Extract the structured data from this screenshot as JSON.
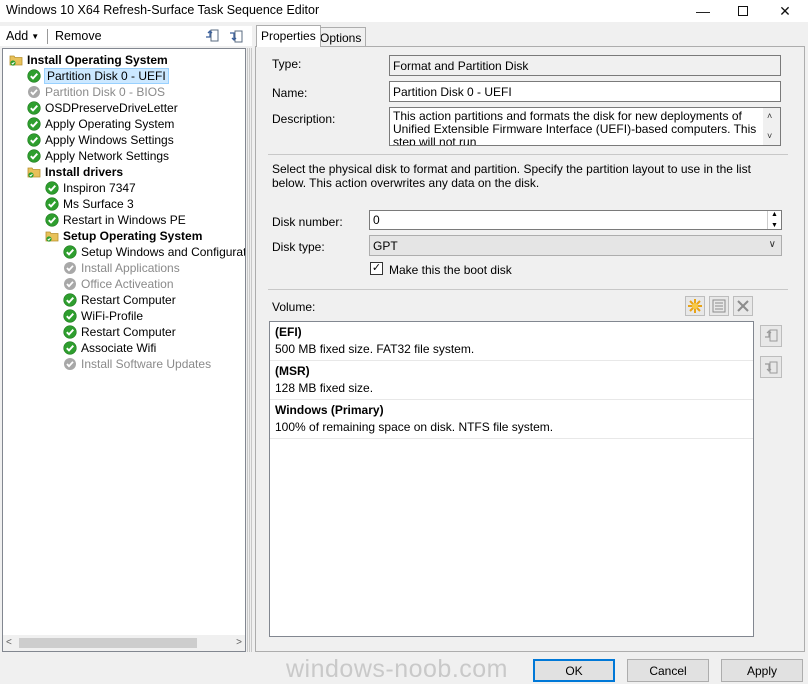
{
  "window": {
    "title": "Windows 10 X64 Refresh-Surface Task Sequence Editor",
    "min_glyph": "—",
    "close_glyph": "✕"
  },
  "toolbar": {
    "add_label": "Add",
    "add_arrow": "▼",
    "remove_label": "Remove"
  },
  "tree": {
    "items": [
      {
        "label": "Install Operating System",
        "type": "group"
      },
      {
        "label": "Partition Disk 0 - UEFI",
        "type": "step",
        "state": "ok"
      },
      {
        "label": "Partition Disk 0 - BIOS",
        "type": "step",
        "state": "disabled"
      },
      {
        "label": "OSDPreserveDriveLetter",
        "type": "step",
        "state": "ok"
      },
      {
        "label": "Apply Operating System",
        "type": "step",
        "state": "ok"
      },
      {
        "label": "Apply Windows Settings",
        "type": "step",
        "state": "ok"
      },
      {
        "label": "Apply Network Settings",
        "type": "step",
        "state": "ok"
      },
      {
        "label": "Install drivers",
        "type": "group"
      },
      {
        "label": "Inspiron 7347",
        "type": "step",
        "state": "ok"
      },
      {
        "label": "Ms Surface 3",
        "type": "step",
        "state": "ok"
      },
      {
        "label": "Restart in Windows PE",
        "type": "step",
        "state": "ok"
      },
      {
        "label": "Setup Operating System",
        "type": "group"
      },
      {
        "label": "Setup Windows and Configuration",
        "type": "step",
        "state": "ok"
      },
      {
        "label": "Install Applications",
        "type": "step",
        "state": "disabled"
      },
      {
        "label": "Office Activeation",
        "type": "step",
        "state": "disabled"
      },
      {
        "label": "Restart Computer",
        "type": "step",
        "state": "ok"
      },
      {
        "label": "WiFi-Profile",
        "type": "step",
        "state": "ok"
      },
      {
        "label": "Restart Computer",
        "type": "step",
        "state": "ok"
      },
      {
        "label": "Associate Wifi",
        "type": "step",
        "state": "ok"
      },
      {
        "label": "Install Software Updates",
        "type": "step",
        "state": "disabled"
      }
    ],
    "scroll_left": "<",
    "scroll_right": ">"
  },
  "tabs": {
    "properties": "Properties",
    "options": "Options"
  },
  "properties": {
    "type_label": "Type:",
    "type_value": "Format and Partition Disk",
    "name_label": "Name:",
    "name_value": "Partition Disk 0 - UEFI",
    "description_label": "Description:",
    "description_value": "This action partitions and formats the disk for new deployments of Unified Extensible Firmware Interface (UEFI)-based computers. This step will not run",
    "scroll_up": "˄",
    "scroll_down": "˅",
    "info_text": "Select the physical disk to format and partition. Specify the partition layout to use in the list below. This action overwrites any data on the disk.",
    "disk_number_label": "Disk number:",
    "disk_number_value": "0",
    "spin_up": "▲",
    "spin_down": "▼",
    "disk_type_label": "Disk type:",
    "disk_type_value": "GPT",
    "disk_type_chevron": "∨",
    "boot_disk_label": "Make this the boot disk",
    "boot_disk_checked": true,
    "check_glyph": "✓",
    "volume_label": "Volume:",
    "volumes": [
      {
        "title": "(EFI)",
        "detail": "500 MB fixed size. FAT32 file system."
      },
      {
        "title": "(MSR)",
        "detail": "128 MB fixed size."
      },
      {
        "title": "Windows (Primary)",
        "detail": "100% of remaining space on disk. NTFS file system."
      }
    ]
  },
  "watermark": "windows-noob.com",
  "buttons": {
    "ok": "OK",
    "cancel": "Cancel",
    "apply": "Apply"
  },
  "colors": {
    "ok_green": "#2e9e2e",
    "disabled_gray": "#a8a8a8",
    "folder_yellow": "#e8c15a",
    "accent_blue": "#0078d7"
  }
}
